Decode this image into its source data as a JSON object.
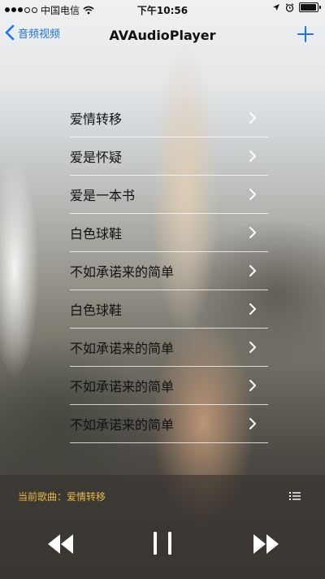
{
  "status_bar": {
    "carrier": "中国电信",
    "time": "下午10:56"
  },
  "nav": {
    "back_label": "音频视频",
    "title": "AVAudioPlayer"
  },
  "songs": [
    {
      "label": "爱情转移"
    },
    {
      "label": "爱是怀疑"
    },
    {
      "label": "爱是一本书"
    },
    {
      "label": "白色球鞋"
    },
    {
      "label": "不如承诺来的简单"
    },
    {
      "label": "白色球鞋"
    },
    {
      "label": "不如承诺来的简单"
    },
    {
      "label": "不如承诺来的简单"
    },
    {
      "label": "不如承诺来的简单"
    }
  ],
  "player": {
    "now_playing": "当前歌曲：爱情转移"
  },
  "colors": {
    "accent_blue": "#1a73e8",
    "now_playing_gold": "#e5b84a"
  },
  "icons": [
    "signal-icon",
    "wifi-icon",
    "location-icon",
    "alarm-icon",
    "battery-icon",
    "back-chevron-icon",
    "add-icon",
    "chevron-right-icon",
    "queue-list-icon",
    "previous-icon",
    "pause-icon",
    "next-icon"
  ]
}
